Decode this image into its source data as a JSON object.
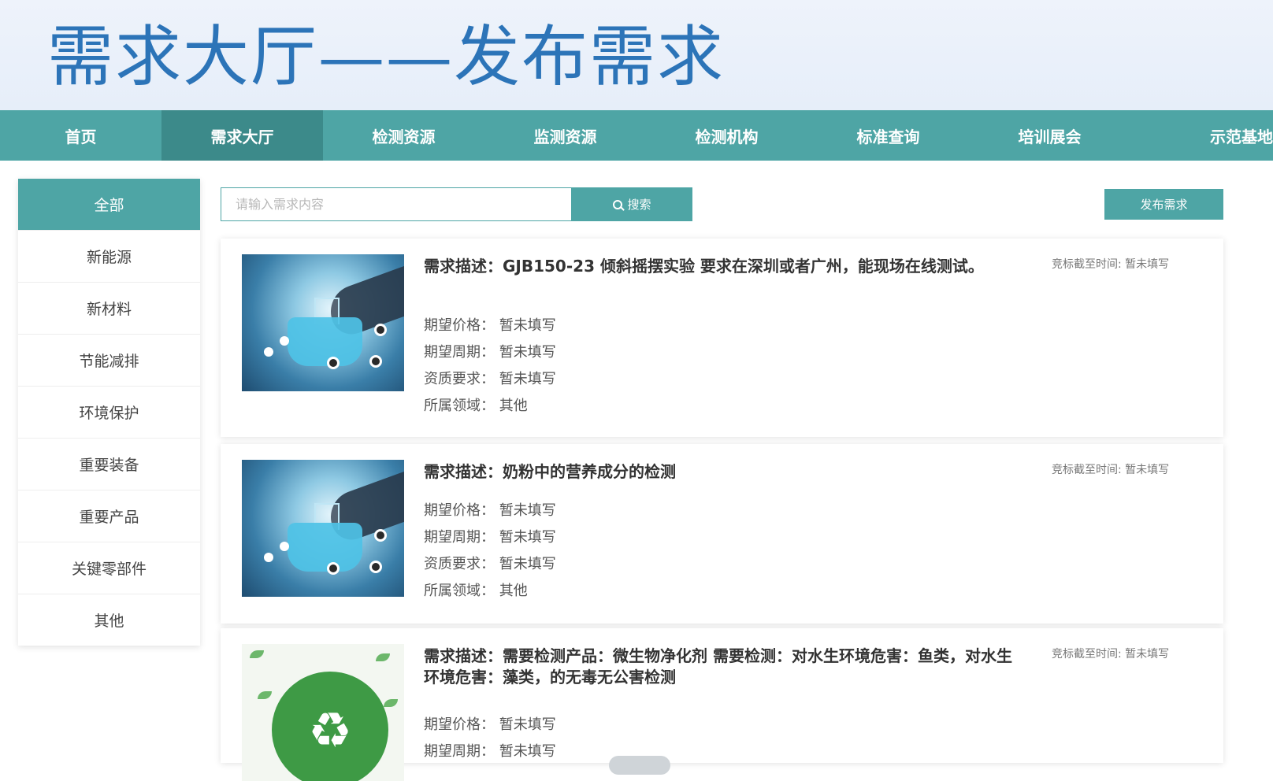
{
  "banner": {
    "title": "需求大厅——发布需求"
  },
  "nav": {
    "items": [
      "首页",
      "需求大厅",
      "检测资源",
      "监测资源",
      "检测机构",
      "标准查询",
      "培训展会",
      "示范基地"
    ],
    "active_index": 1
  },
  "sidebar": {
    "items": [
      "全部",
      "新能源",
      "新材料",
      "节能减排",
      "环境保护",
      "重要装备",
      "重要产品",
      "关键零部件",
      "其他"
    ],
    "active_index": 0
  },
  "search": {
    "placeholder": "请输入需求内容",
    "button_label": "搜索"
  },
  "publish_label": "发布需求",
  "cards": [
    {
      "image": "lab-flask-image",
      "description": "需求描述：GJB150-23 倾斜摇摆实验 要求在深圳或者广州，能现场在线测试。",
      "deadline": "竞标截至时间: 暂未填写",
      "fields": [
        "期望价格： 暂未填写",
        "期望周期： 暂未填写",
        "资质要求： 暂未填写",
        "所属领域： 其他"
      ]
    },
    {
      "image": "lab-flask-image",
      "description": "需求描述：奶粉中的营养成分的检测",
      "deadline": "竞标截至时间: 暂未填写",
      "fields": [
        "期望价格： 暂未填写",
        "期望周期： 暂未填写",
        "资质要求： 暂未填写",
        "所属领域： 其他"
      ]
    },
    {
      "image": "recycle-eco-image",
      "description": "需求描述：需要检测产品：微生物净化剂 需要检测：对水生环境危害：鱼类，对水生环境危害：藻类，的无毒无公害检测",
      "deadline": "竞标截至时间: 暂未填写",
      "fields": [
        "期望价格： 暂未填写",
        "期望周期： 暂未填写"
      ]
    }
  ],
  "colors": {
    "teal": "#4ea5a5",
    "teal_dark": "#3c8a8a",
    "title_blue": "#2c74b8"
  }
}
